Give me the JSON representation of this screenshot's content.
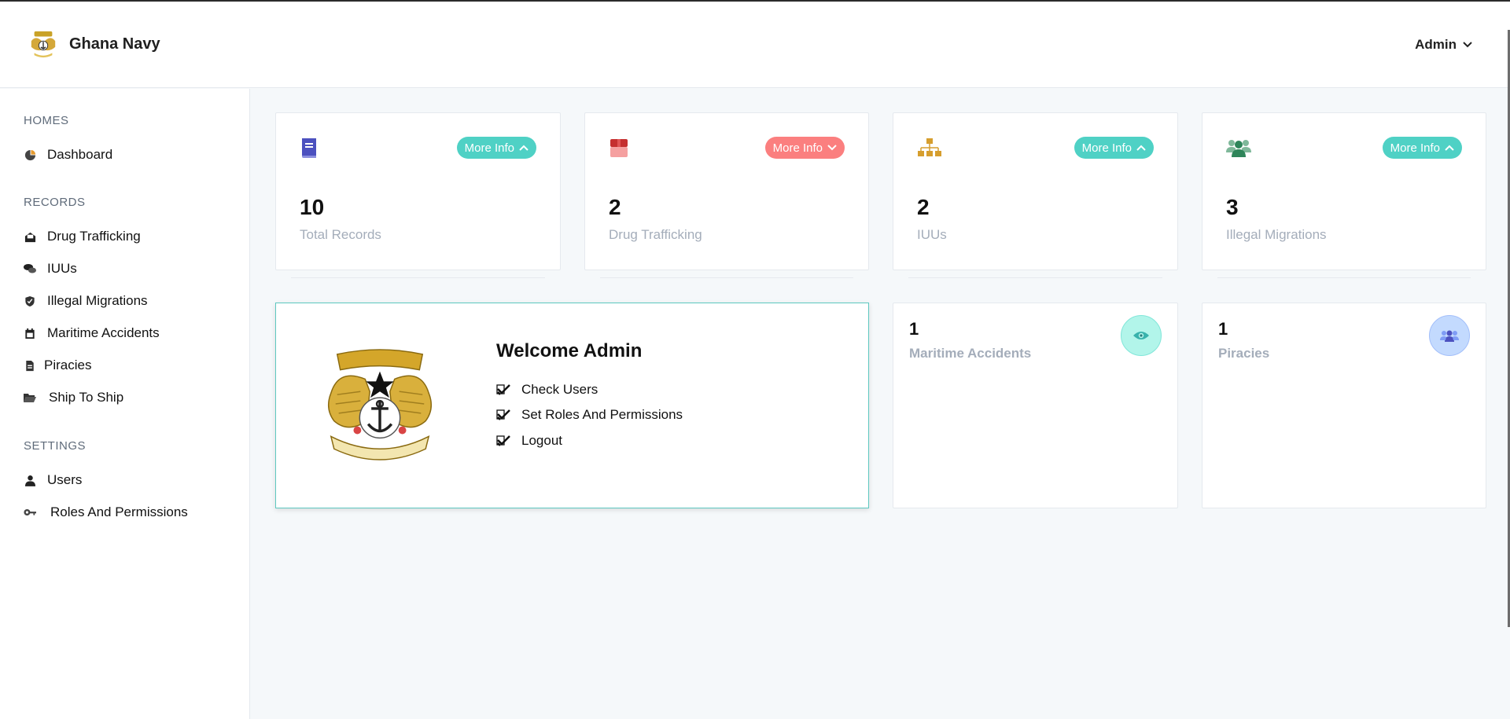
{
  "app": {
    "brand_name": "Ghana Navy"
  },
  "header": {
    "user_name": "Admin"
  },
  "colors": {
    "teal": "#4fd1c5",
    "coral": "#fb7f7f",
    "indigo": "#4c51bf",
    "gold": "#d69e2e",
    "green": "#2f855a"
  },
  "sidebar": {
    "sections": [
      {
        "title": "HOMES",
        "items": [
          {
            "label": "Dashboard",
            "icon": "pie-chart-icon"
          }
        ]
      },
      {
        "title": "RECORDS",
        "items": [
          {
            "label": "Drug Trafficking",
            "icon": "envelope-open-icon"
          },
          {
            "label": "IUUs",
            "icon": "comments-icon"
          },
          {
            "label": "Illegal Migrations",
            "icon": "shield-icon"
          },
          {
            "label": "Maritime Accidents",
            "icon": "calendar-icon"
          },
          {
            "label": "Piracies",
            "icon": "file-icon"
          },
          {
            "label": "Ship To Ship",
            "icon": "folder-open-icon"
          }
        ]
      },
      {
        "title": "SETTINGS",
        "items": [
          {
            "label": "Users",
            "icon": "user-icon"
          },
          {
            "label": "Roles And Permissions",
            "icon": "key-icon"
          }
        ]
      }
    ]
  },
  "stats": [
    {
      "value": "10",
      "label": "Total Records",
      "button": "More Info",
      "icon": "book-icon"
    },
    {
      "value": "2",
      "label": "Drug Trafficking",
      "button": "More Info",
      "icon": "box-icon"
    },
    {
      "value": "2",
      "label": "IUUs",
      "button": "More Info",
      "icon": "sitemap-icon"
    },
    {
      "value": "3",
      "label": "Illegal Migrations",
      "button": "More Info",
      "icon": "users-icon"
    }
  ],
  "welcome": {
    "title": "Welcome Admin",
    "items": [
      "Check Users",
      "Set Roles And Permissions",
      "Logout"
    ]
  },
  "mini_stats": [
    {
      "value": "1",
      "label": "Maritime Accidents",
      "icon": "eye-icon"
    },
    {
      "value": "1",
      "label": "Piracies",
      "icon": "users-icon"
    }
  ]
}
